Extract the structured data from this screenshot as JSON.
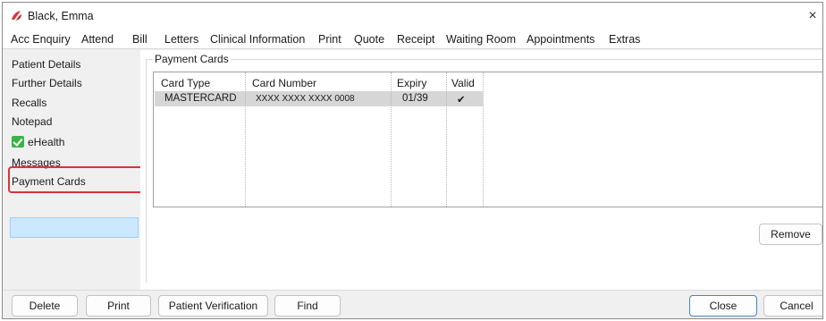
{
  "window": {
    "title": "Black, Emma",
    "close_glyph": "×",
    "app_icon": "app-logo-icon"
  },
  "menu": {
    "items": [
      "Acc Enquiry",
      "Attend",
      "Bill",
      "Letters",
      "Clinical Information",
      "Print",
      "Quote",
      "Receipt",
      "Waiting Room",
      "Appointments",
      "Extras"
    ]
  },
  "sidebar": {
    "items": [
      "Patient Details",
      "Further Details",
      "Recalls",
      "Notepad",
      "eHealth",
      "Messages",
      "Payment Cards"
    ],
    "selected": "Payment Cards"
  },
  "payment_cards": {
    "group_title": "Payment Cards",
    "columns": [
      "Card Type",
      "Card Number",
      "Expiry",
      "Valid"
    ],
    "rows": [
      {
        "card_type": "MASTERCARD",
        "card_number": "XXXX XXXX XXXX 0008",
        "expiry": "01/39",
        "valid": "✔"
      }
    ],
    "remove_label": "Remove"
  },
  "footer": {
    "delete_label": "Delete",
    "print_label": "Print",
    "patient_verification_label": "Patient Verification",
    "find_label": "Find",
    "close_label": "Close",
    "cancel_label": "Cancel"
  },
  "colors": {
    "highlight": "#d9343b",
    "selection": "#cce8ff",
    "ehealth": "#3cb34a",
    "default_button_border": "#4a82c6"
  }
}
